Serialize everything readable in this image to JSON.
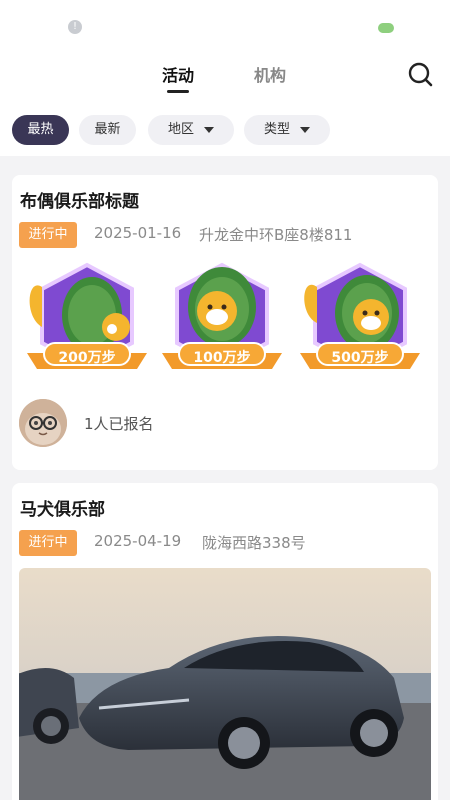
{
  "tabs": [
    {
      "label": "活动",
      "active": true
    },
    {
      "label": "机构",
      "active": false
    }
  ],
  "filters": [
    {
      "label": "最热",
      "active": true,
      "dropdown": false
    },
    {
      "label": "最新",
      "active": false,
      "dropdown": false
    },
    {
      "label": "地区",
      "active": false,
      "dropdown": true
    },
    {
      "label": "类型",
      "active": false,
      "dropdown": true
    }
  ],
  "activities": [
    {
      "title": "布偶俱乐部标题",
      "status": "进行中",
      "date": "2025-01-16",
      "address": "升龙金中环B座8楼811",
      "medals": [
        {
          "label": "200万步",
          "icon": "pinecone-fox-medal-icon"
        },
        {
          "label": "100万步",
          "icon": "pinecone-fox-medal-icon"
        },
        {
          "label": "500万步",
          "icon": "pinecone-fox-medal-icon"
        }
      ],
      "signup_text": "1人已报名"
    },
    {
      "title": "马犬俱乐部",
      "status": "进行中",
      "date": "2025-04-19",
      "address": "陇海西路338号",
      "cover": "car-photo"
    }
  ],
  "colors": {
    "accent_chip": "#3a3656",
    "status_badge": "#f5a14e",
    "medal_purple": "#7f4ad1",
    "medal_ribbon": "#f29a2a"
  },
  "icons": {
    "search": "search-icon",
    "status_left": "alert-icon",
    "status_right": "cloud-icon"
  }
}
